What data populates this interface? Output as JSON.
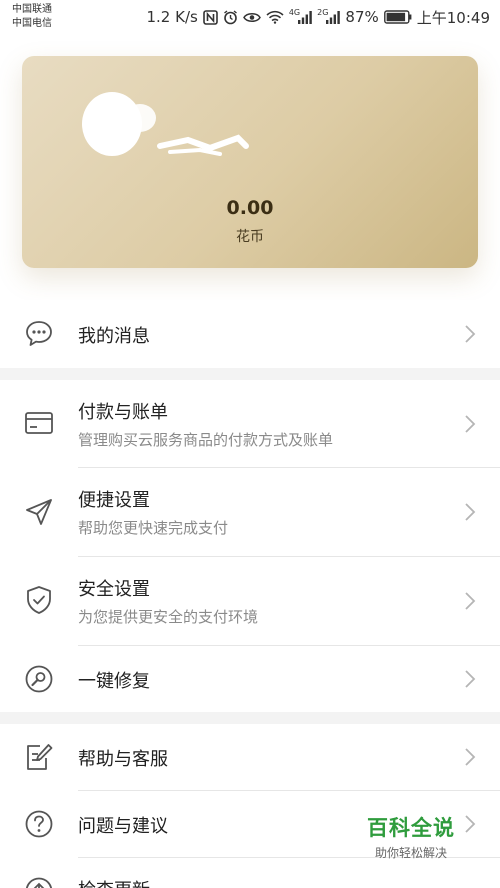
{
  "status_bar": {
    "carrier_1": "中国联通",
    "carrier_2": "中国电信",
    "speed": "1.2 K/s",
    "net_1": "4G",
    "net_2": "2G",
    "battery": "87%",
    "time": "上午10:49"
  },
  "account": {
    "balance": "0.00",
    "unit": "花币"
  },
  "menu": {
    "messages": {
      "title": "我的消息"
    },
    "payment": {
      "title": "付款与账单",
      "subtitle": "管理购买云服务商品的付款方式及账单"
    },
    "quick": {
      "title": "便捷设置",
      "subtitle": "帮助您更快速完成支付"
    },
    "security": {
      "title": "安全设置",
      "subtitle": "为您提供更安全的支付环境"
    },
    "repair": {
      "title": "一键修复"
    },
    "help": {
      "title": "帮助与客服"
    },
    "feedback": {
      "title": "问题与建议"
    },
    "update": {
      "title": "检查更新"
    }
  },
  "watermark": {
    "title": "百科全说",
    "subtitle": "助你轻松解决"
  }
}
